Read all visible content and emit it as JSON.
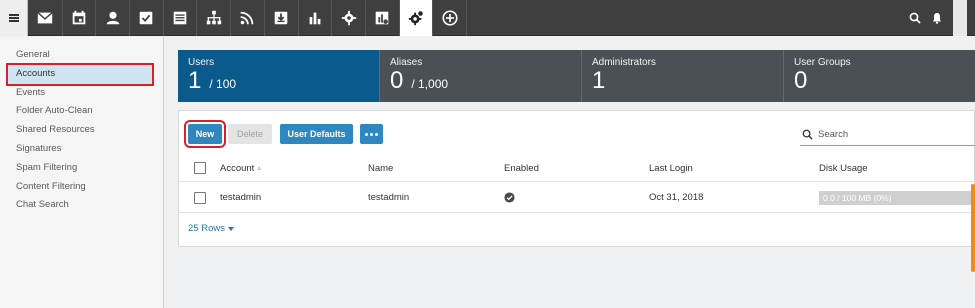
{
  "nav": {
    "icons": [
      "envelope-icon",
      "calendar-icon",
      "contacts-icon",
      "tasks-icon",
      "notes-icon",
      "organization-icon",
      "rss-icon",
      "download-icon",
      "reports-icon",
      "settings-icon",
      "charts-settings-icon",
      "system-settings-icon",
      "add-icon"
    ],
    "active_index": 11
  },
  "sidebar": {
    "items": [
      {
        "label": "General"
      },
      {
        "label": "Accounts"
      },
      {
        "label": "Events"
      },
      {
        "label": "Folder Auto-Clean"
      },
      {
        "label": "Shared Resources"
      },
      {
        "label": "Signatures"
      },
      {
        "label": "Spam Filtering"
      },
      {
        "label": "Content Filtering"
      },
      {
        "label": "Chat Search"
      }
    ],
    "active_index": 1
  },
  "cards": [
    {
      "label": "Users",
      "value": "1",
      "max": "/ 100"
    },
    {
      "label": "Aliases",
      "value": "0",
      "max": "/ 1,000"
    },
    {
      "label": "Administrators",
      "value": "1",
      "max": ""
    },
    {
      "label": "User Groups",
      "value": "0",
      "max": ""
    }
  ],
  "toolbar": {
    "new_label": "New",
    "delete_label": "Delete",
    "user_defaults_label": "User Defaults",
    "search_placeholder": "Search"
  },
  "table": {
    "columns": [
      "Account",
      "Name",
      "Enabled",
      "Last Login",
      "Disk Usage"
    ],
    "rows": [
      {
        "account": "testadmin",
        "name": "testadmin",
        "enabled": true,
        "last_login": "Oct 31, 2018",
        "disk_usage": "0.0 / 100 MB (0%)"
      }
    ]
  },
  "footer": {
    "rows_label": "25 Rows"
  },
  "colors": {
    "accent": "#2e87c1",
    "active_card": "#0b5a8c",
    "highlight": "#d6202e"
  }
}
